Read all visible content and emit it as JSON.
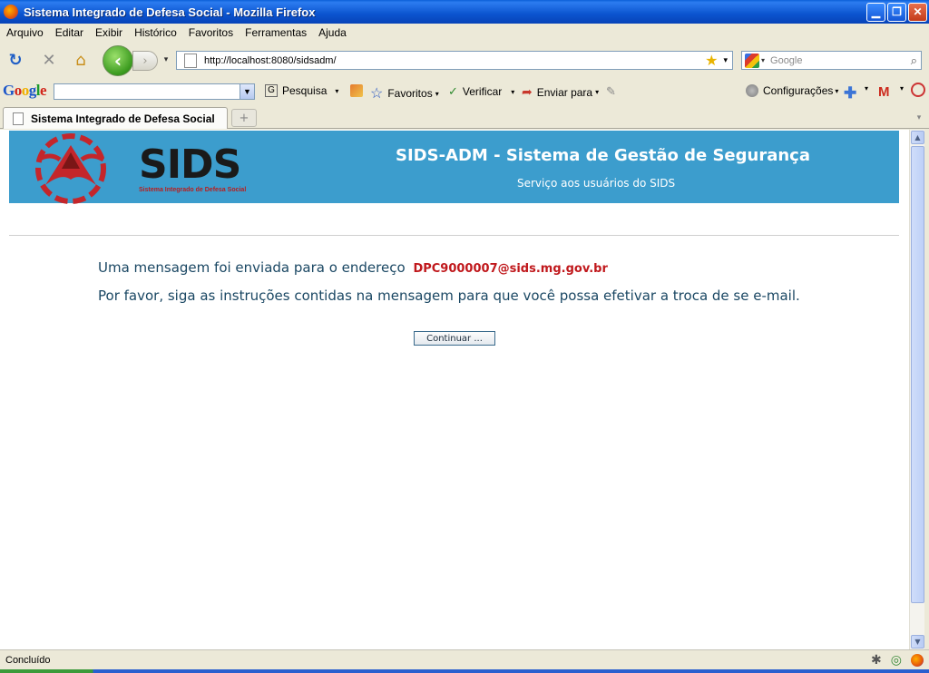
{
  "window": {
    "title": "Sistema Integrado de Defesa Social - Mozilla Firefox"
  },
  "menu": {
    "items": [
      "Arquivo",
      "Editar",
      "Exibir",
      "Histórico",
      "Favoritos",
      "Ferramentas",
      "Ajuda"
    ]
  },
  "nav": {
    "url": "http://localhost:8080/sidsadm/",
    "search_placeholder": "Google"
  },
  "google_toolbar": {
    "logo": "Google",
    "search_label": "Pesquisa",
    "bookmarks_label": "Favoritos",
    "check_label": "Verificar",
    "send_label": "Enviar para",
    "settings_label": "Configurações"
  },
  "tabs": [
    {
      "label": "Sistema Integrado de Defesa Social"
    }
  ],
  "banner": {
    "logo_text": "SIDS",
    "logo_subtitle": "Sistema Integrado de Defesa Social",
    "title": "SIDS-ADM - Sistema de Gestão de Segurança",
    "subtitle": "Serviço aos usuários do SIDS"
  },
  "message": {
    "line1": "Uma mensagem foi enviada para o endereço",
    "email": "DPC9000007@sids.mg.gov.br",
    "line2": "Por favor, siga as instruções contidas na mensagem para que você possa efetivar a troca de se e-mail.",
    "continue_label": "Continuar ..."
  },
  "status": {
    "text": "Concluído"
  },
  "colors": {
    "banner": "#3c9dcd",
    "email": "#c0181c",
    "message_text": "#1a4763"
  }
}
